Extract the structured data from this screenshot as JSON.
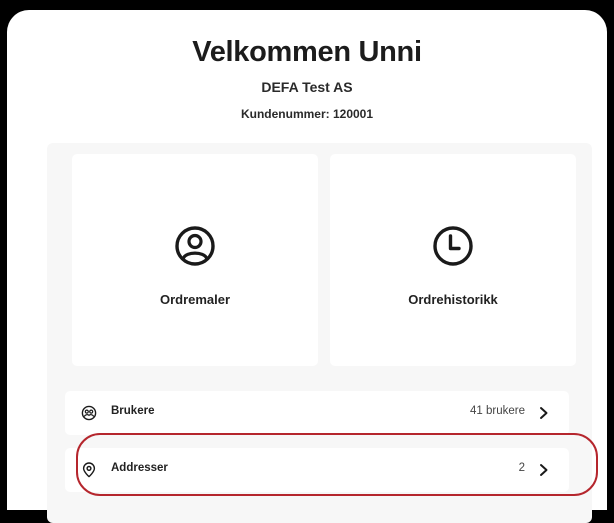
{
  "header": {
    "greeting": "Velkommen Unni",
    "company": "DEFA Test AS",
    "customer_number": "Kundenummer: 120001"
  },
  "tiles": [
    {
      "label": "Ordremaler",
      "icon": "user-circle-icon"
    },
    {
      "label": "Ordrehistorikk",
      "icon": "clock-icon"
    }
  ],
  "rows": [
    {
      "label": "Brukere",
      "count": "41 brukere",
      "icon": "users-circle-icon"
    },
    {
      "label": "Addresser",
      "count": "2",
      "icon": "location-pin-icon"
    }
  ],
  "colors": {
    "highlight": "#b5262d",
    "panel_background": "#ffffff",
    "content_background": "#f7f7f7"
  }
}
